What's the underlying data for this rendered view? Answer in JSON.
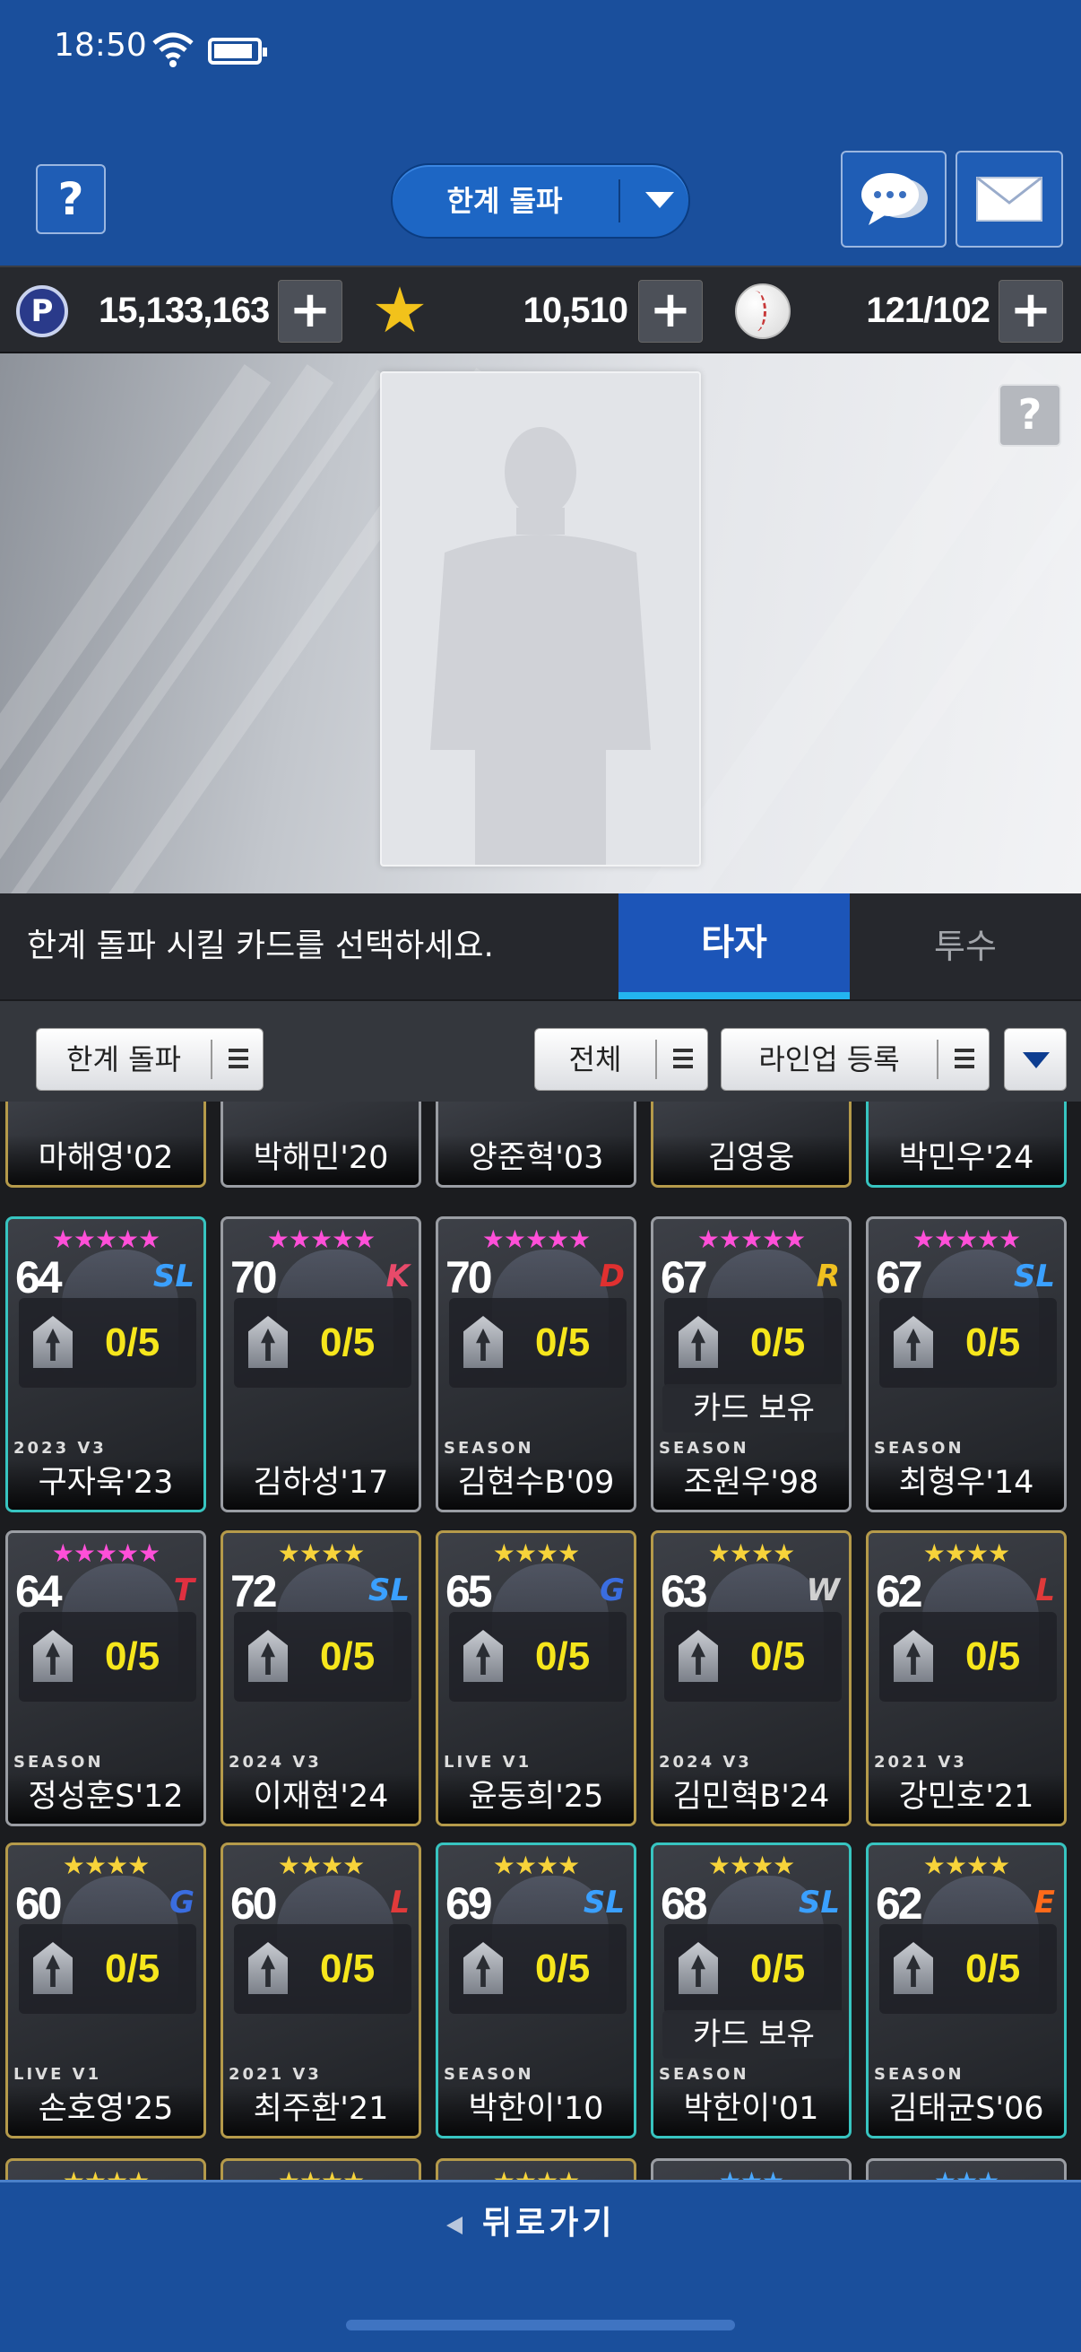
{
  "status_bar": {
    "time": "18:50"
  },
  "header": {
    "help_label": "?",
    "mode_select": {
      "selected": "한계 돌파"
    },
    "chat_icon": "chat-bubble-icon",
    "mail_icon": "envelope-icon"
  },
  "currency": {
    "points": {
      "icon": "P",
      "value": "15,133,163"
    },
    "stars": {
      "icon": "★",
      "value": "10,510"
    },
    "balls": {
      "value": "121/102"
    },
    "plus_label": "+"
  },
  "hero": {
    "help_label": "?"
  },
  "tabs": {
    "instruction": "한계 돌파 시킬 카드를 선택하세요.",
    "batter": "타자",
    "pitcher": "투수",
    "active": "타자"
  },
  "filters": {
    "limit_break": "한계 돌파",
    "all": "전체",
    "lineup": "라인업 등록"
  },
  "owned_label": "카드 보유",
  "top_row": [
    {
      "name": "마해영'02"
    },
    {
      "name": "박해민'20"
    },
    {
      "name": "양준혁'03"
    },
    {
      "name": "김영웅"
    },
    {
      "name": "박민우'24"
    }
  ],
  "cards": [
    {
      "rating": "64",
      "team": "SL",
      "stars": "★★★★★",
      "limit": "0/5",
      "name": "구자욱'23",
      "owned": false,
      "star_color": "#ff4fd8",
      "border": "#37c4c0",
      "season": "2023 V3"
    },
    {
      "rating": "70",
      "team": "K",
      "stars": "★★★★★",
      "limit": "0/5",
      "name": "김하성'17",
      "owned": false,
      "star_color": "#ff4fd8",
      "border": "#9a9da3",
      "season": ""
    },
    {
      "rating": "70",
      "team": "D",
      "stars": "★★★★★",
      "limit": "0/5",
      "name": "김현수B'09",
      "owned": false,
      "star_color": "#ff4fd8",
      "border": "#9a9da3",
      "season": "SEASON"
    },
    {
      "rating": "67",
      "team": "R",
      "stars": "★★★★★",
      "limit": "0/5",
      "name": "조원우'98",
      "owned": true,
      "star_color": "#ff4fd8",
      "border": "#9a9da3",
      "season": "SEASON"
    },
    {
      "rating": "67",
      "team": "SL",
      "stars": "★★★★★",
      "limit": "0/5",
      "name": "최형우'14",
      "owned": false,
      "star_color": "#ff4fd8",
      "border": "#9a9da3",
      "season": "SEASON"
    },
    {
      "rating": "64",
      "team": "T",
      "stars": "★★★★★",
      "limit": "0/5",
      "name": "정성훈S'12",
      "owned": false,
      "star_color": "#ff4fd8",
      "border": "#9a9da3",
      "season": "SEASON"
    },
    {
      "rating": "72",
      "team": "SL",
      "stars": "★★★★",
      "limit": "0/5",
      "name": "이재현'24",
      "owned": false,
      "star_color": "#f7d33a",
      "border": "#b59a4a",
      "season": "2024 V3"
    },
    {
      "rating": "65",
      "team": "G",
      "stars": "★★★★",
      "limit": "0/5",
      "name": "윤동희'25",
      "owned": false,
      "star_color": "#f7d33a",
      "border": "#b59a4a",
      "season": "LIVE V1"
    },
    {
      "rating": "63",
      "team": "W",
      "stars": "★★★★",
      "limit": "0/5",
      "name": "김민혁B'24",
      "owned": false,
      "star_color": "#f7d33a",
      "border": "#b59a4a",
      "season": "2024 V3"
    },
    {
      "rating": "62",
      "team": "L",
      "stars": "★★★★",
      "limit": "0/5",
      "name": "강민호'21",
      "owned": false,
      "star_color": "#f7d33a",
      "border": "#b59a4a",
      "season": "2021 V3"
    },
    {
      "rating": "60",
      "team": "G",
      "stars": "★★★★",
      "limit": "0/5",
      "name": "손호영'25",
      "owned": false,
      "star_color": "#f7d33a",
      "border": "#b59a4a",
      "season": "LIVE V1"
    },
    {
      "rating": "60",
      "team": "L",
      "stars": "★★★★",
      "limit": "0/5",
      "name": "최주환'21",
      "owned": false,
      "star_color": "#f7d33a",
      "border": "#b59a4a",
      "season": "2021 V3"
    },
    {
      "rating": "69",
      "team": "SL",
      "stars": "★★★★",
      "limit": "0/5",
      "name": "박한이'10",
      "owned": false,
      "star_color": "#f7d33a",
      "border": "#37c4c0",
      "season": "SEASON"
    },
    {
      "rating": "68",
      "team": "SL",
      "stars": "★★★★",
      "limit": "0/5",
      "name": "박한이'01",
      "owned": true,
      "star_color": "#f7d33a",
      "border": "#37c4c0",
      "season": "SEASON"
    },
    {
      "rating": "62",
      "team": "E",
      "stars": "★★★★",
      "limit": "0/5",
      "name": "김태균S'06",
      "owned": false,
      "star_color": "#f7d33a",
      "border": "#37c4c0",
      "season": "SEASON"
    }
  ],
  "footer": {
    "back_label": "뒤로가기"
  }
}
